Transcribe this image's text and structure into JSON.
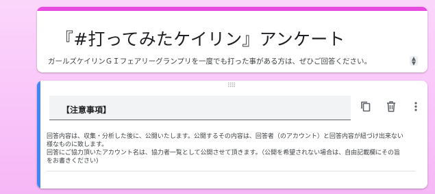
{
  "header": {
    "title": "『#打ってみたケイリン』アンケート",
    "description": "ガールズケイリンＧＩフェアリーグランプリを一度でも打った事がある方は、ぜひご回答ください。",
    "accent_color": "#e84be0"
  },
  "question": {
    "title": "【注意事項】",
    "body_lines": [
      "回答内容は、収集・分析した後に、公開いたします。公開するその内容は、回答者（のアカウント）と回答内容が紐づけ出来ない",
      "様なものに致します。",
      "回答にご協力頂いたアカウント名は、協力者一覧として公開させて頂きます。（公開を希望されない場合は、自由記載欄にその旨",
      "をお書きください)"
    ],
    "accent_color": "#4285f4",
    "tools": [
      "copy-icon",
      "delete-icon",
      "more-vert-icon"
    ]
  }
}
